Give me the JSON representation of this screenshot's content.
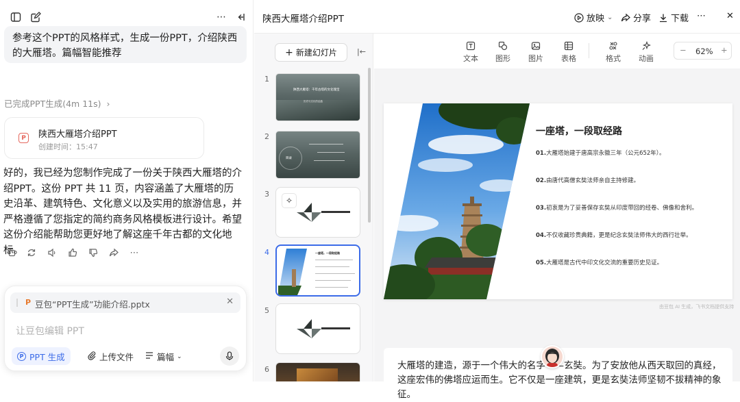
{
  "left": {
    "user_message": "参考这个PPT的风格样式，生成一份PPT，介绍陕西的大雁塔。篇幅智能推荐",
    "done_status": "已完成PPT生成(4m 11s)",
    "file_card": {
      "name": "陕西大雁塔介绍PPT",
      "time": "创建时间：15:47",
      "icon": "ppt-file-icon"
    },
    "reply": "好的，我已经为您制作完成了一份关于陕西大雁塔的介绍PPT。这份 PPT 共 11 页，内容涵盖了大雁塔的历史沿革、建筑特色、文化意义以及实用的旅游信息，并严格遵循了您指定的简约商务风格模板进行设计。希望这份介绍能帮助您更好地了解这座千年古都的文化地标。",
    "composer": {
      "attachment": "豆包“PPT生成”功能介绍.pptx",
      "placeholder": "让豆包编辑 PPT",
      "ppt_chip": "PPT 生成",
      "upload": "上传文件",
      "length": "篇幅"
    }
  },
  "header": {
    "title": "陕西大雁塔介绍PPT",
    "present": "放映",
    "share": "分享",
    "download": "下载"
  },
  "thumbs": {
    "new_slide": "新建幻灯片",
    "numbers": [
      "1",
      "2",
      "3",
      "4",
      "5",
      "6"
    ],
    "t1_title": "陕西大雁塔：千年古塔的文化瑰宝",
    "t1_sub": "历史与文化的结晶",
    "t2_label": "目录",
    "t4_title": "一座塔，一段取经路"
  },
  "toolbar": {
    "text": "文本",
    "shape": "图形",
    "image": "图片",
    "table": "表格",
    "format": "格式",
    "animation": "动画",
    "zoom": "62%"
  },
  "slide": {
    "title": "一座塔，一段取经路",
    "points": [
      {
        "num": "01.",
        "text": "大雁塔始建于唐高宗永徽三年（公元652年）。"
      },
      {
        "num": "02.",
        "text": "由唐代高僧玄奘法师亲自主持修建。"
      },
      {
        "num": "03.",
        "text": "初衷是为了妥善保存玄奘从印度带回的经卷、佛像和舍利。"
      },
      {
        "num": "04.",
        "text": "不仅收藏珍贵典籍，更是纪念玄奘法师伟大的西行壮举。"
      },
      {
        "num": "05.",
        "text": "大雁塔是古代中印文化交流的重要历史见证。"
      }
    ],
    "watermark": "由豆包 AI 生成，飞书文档提供支持"
  },
  "notes": "大雁塔的建造，源于一个伟大的名字——玄奘。为了安放他从西天取回的真经，这座宏伟的佛塔应运而生。它不仅是一座建筑，更是玄奘法师坚韧不拔精神的象征。",
  "colors": {
    "accent": "#3b6be8",
    "ppt_red": "#e5675d"
  }
}
